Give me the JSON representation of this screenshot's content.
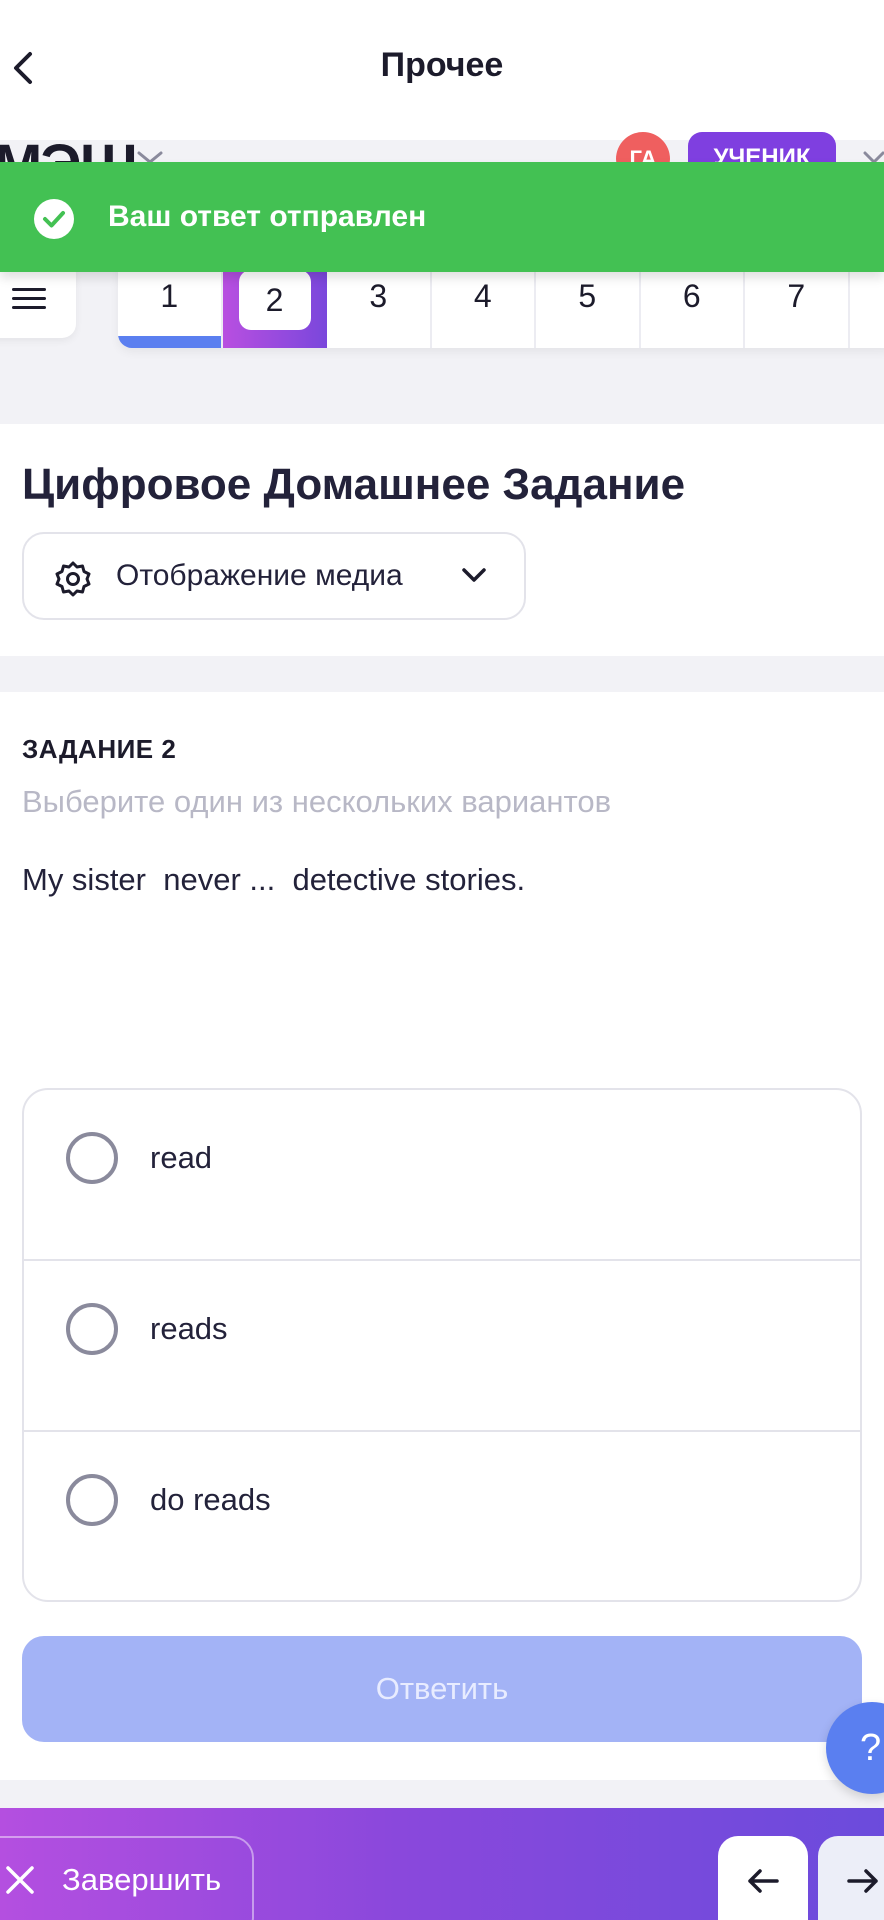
{
  "header": {
    "title": "Прочее",
    "brand": "МЭШ",
    "avatar_initials": "ГА",
    "role_badge": "УЧЕНИК"
  },
  "toast": {
    "message": "Ваш ответ отправлен",
    "color": "#43c153"
  },
  "tabs": [
    {
      "label": "1",
      "state": "done"
    },
    {
      "label": "2",
      "state": "active"
    },
    {
      "label": "3",
      "state": "pending"
    },
    {
      "label": "4",
      "state": "pending"
    },
    {
      "label": "5",
      "state": "pending"
    },
    {
      "label": "6",
      "state": "pending"
    },
    {
      "label": "7",
      "state": "pending"
    }
  ],
  "homework": {
    "title": "Цифровое Домашнее Задание",
    "media_select": "Отображение медиа"
  },
  "task": {
    "number": "ЗАДАНИЕ 2",
    "instruction": "Выберите один из нескольких вариантов",
    "question": "My sister  never ...  detective stories.",
    "options": [
      {
        "label": "read"
      },
      {
        "label": "reads"
      },
      {
        "label": "do reads"
      }
    ],
    "submit_label": "Ответить"
  },
  "help": {
    "label": "?"
  },
  "bottom_bar": {
    "finish_label": "Завершить"
  },
  "colors": {
    "accent_purple": "#7f3fe0",
    "accent_blue": "#5b7ff0",
    "submit_disabled": "#a3b3f6"
  }
}
